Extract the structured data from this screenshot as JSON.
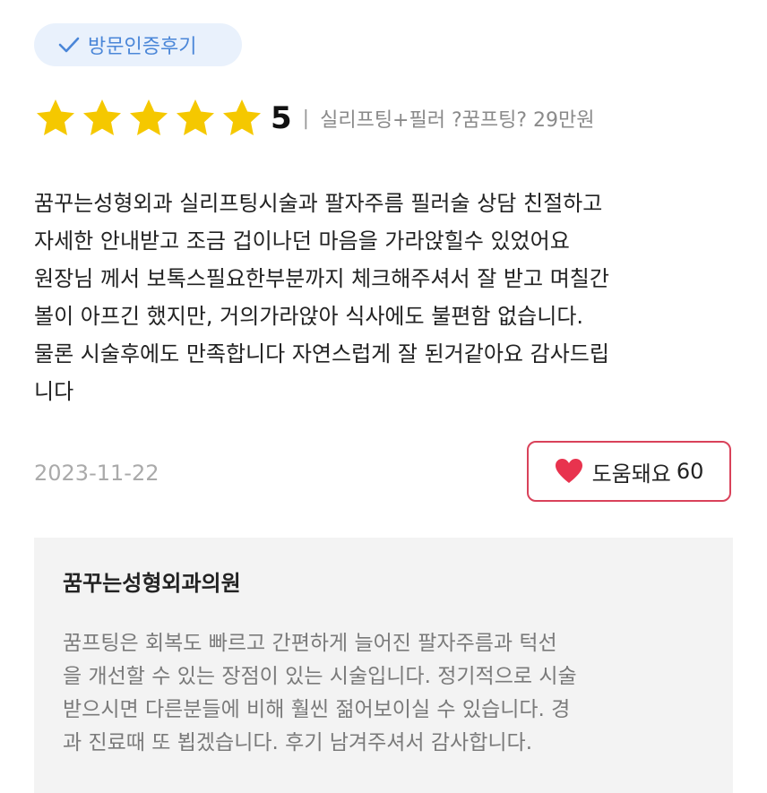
{
  "badge": {
    "label": "방문인증후기",
    "icon": "check-icon",
    "color": "#4a86d8"
  },
  "rating": {
    "stars": 5,
    "score": "5",
    "separator": "|",
    "treatment": "실리프팅+필러 ?꿈프팅? 29만원",
    "star_color": "#f5c800"
  },
  "review": {
    "text": "꿈꾸는성형외과 실리프팅시술과 팔자주름 필러술 상담 친절하고\n자세한 안내받고 조금 겁이나던 마음을 가라앉힐수 있었어요\n원장님 께서 보톡스필요한부분까지 체크해주셔서 잘 받고 며칠간\n볼이 아프긴 했지만, 거의가라앉아 식사에도 불편함 없습니다.\n물론 시술후에도 만족합니다 자연스럽게 잘 된거같아요 감사드립\n니다",
    "date": "2023-11-22"
  },
  "helpful": {
    "label": "도움돼요",
    "count": "60",
    "icon": "heart-icon",
    "color": "#e8334e"
  },
  "reply": {
    "author": "꿈꾸는성형외과의원",
    "text": "꿈프팅은 회복도 빠르고 간편하게 늘어진 팔자주름과 턱선\n을 개선할 수 있는 장점이 있는 시술입니다. 정기적으로 시술\n받으시면 다른분들에 비해 훨씬 젊어보이실 수 있습니다. 경\n과 진료때 또 뵙겠습니다. 후기 남겨주셔서 감사합니다."
  }
}
